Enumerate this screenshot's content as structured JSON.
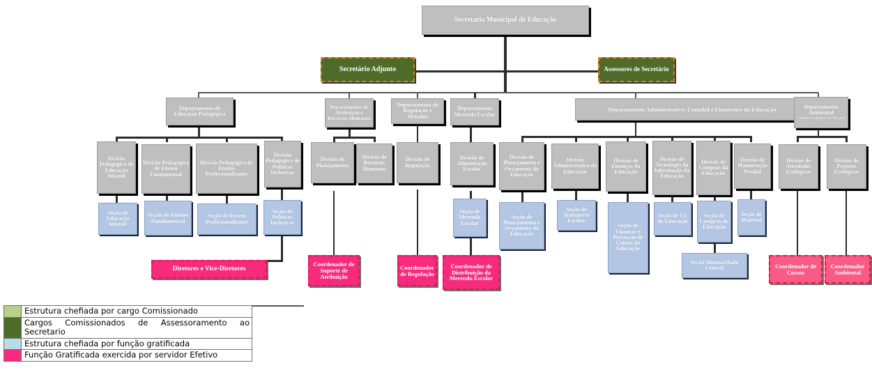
{
  "diagram": {
    "title": "Organograma Secretaria Municipal de Educacao",
    "colors": {
      "comissionado": "#b8d08a",
      "assessoramento": "#4f6b28",
      "funcao_gratificada": "#b3c6e3",
      "fg_efetivo": "#f72a7d",
      "gray_box": "#bfbfbf",
      "dashed_orange": "#e07b1e"
    }
  },
  "root": {
    "label": "Secretaria Municipal de Educação"
  },
  "advisors": [
    {
      "label": "Secretário Adjunto"
    },
    {
      "label": "Assessores de Secretário"
    }
  ],
  "departments": [
    {
      "label": "Departamento de Educação Pedagógica"
    },
    {
      "label": "Departamento de Atribuição e Recursos Humanos"
    },
    {
      "label": "Departamento de Regulação e Métodos"
    },
    {
      "label": "Departamento Merenda Escolar"
    },
    {
      "label": "Departamento Administrativo, Contábil e Financeiro da Educação"
    },
    {
      "label": "Departamento Ambiental",
      "sublabel": "Parque ecológico da Maçata"
    }
  ],
  "divisions": [
    {
      "label": "Divisão Pedagógica de Educação Infantil"
    },
    {
      "label": "Divisão Pedagógica de Ensino Fundamental"
    },
    {
      "label": "Divisão Pedagógica de Ensino Profissionalizante"
    },
    {
      "label": "Divisão Pedagógica de Políticas Inclusivas"
    },
    {
      "label": "Divisão de Planejamento"
    },
    {
      "label": "Divisão de Recursos Humanos"
    },
    {
      "label": "Divisão de Regulação"
    },
    {
      "label": "Divisão de Alimentação Escolar"
    },
    {
      "label": "Divisão de Planejamento e Orçamento da Educação"
    },
    {
      "label": "Divisão Administrativa da Educação"
    },
    {
      "label": "Divisão de Finanças da Educação"
    },
    {
      "label": "Divisão de Tecnologia da Informação da Educação"
    },
    {
      "label": "Divisão de Compras da Educação"
    },
    {
      "label": "Divisão de Manutenção Predial"
    },
    {
      "label": "Divisão de Atividades Ecológicas"
    },
    {
      "label": "Divisão de Projetos Ecológicos"
    }
  ],
  "sections": [
    {
      "label": "Seção de Educação Infantil"
    },
    {
      "label": "Seção de Ensino Fundamental"
    },
    {
      "label": "Seção de Ensino Profissionalizante"
    },
    {
      "label": "Seção de Políticas Inclusivas"
    },
    {
      "label": "Seção de Merenda Escolar"
    },
    {
      "label": "Seção de Planejamento e Orçamento da Educação"
    },
    {
      "label": "Seção de Transporte Escolar"
    },
    {
      "label": "Seção de Finanças e Prestação de Contas da Educação"
    },
    {
      "label": "Seção de T.I. da Educação"
    },
    {
      "label": "Seção de Compras da Educação"
    },
    {
      "label": "Seção de Material"
    },
    {
      "label": "Seção Almoxarifado Central"
    }
  ],
  "coordinators": [
    {
      "label": "Diretores e Vice-Diretores"
    },
    {
      "label": "Coordenador de Suporte de Atribuição"
    },
    {
      "label": "Coordenador de Regulação"
    },
    {
      "label": "Coordenador de Distribuição da Merenda Escolar"
    },
    {
      "label": "Coordenador de Cursos"
    },
    {
      "label": "Coordenador Ambiental"
    }
  ],
  "legend": [
    {
      "color": "#b8d08a",
      "text": "Estrutura chefiada por cargo Comissionado"
    },
    {
      "color": "#4f6b28",
      "text": "Cargos Comissionados de Assessoramento ao Secretario"
    },
    {
      "color": "#b8dbe8",
      "text": "Estrutura chefiada por função gratificada"
    },
    {
      "color": "#f72a7d",
      "text": "Função Gratificada exercida por servidor Efetivo"
    }
  ]
}
